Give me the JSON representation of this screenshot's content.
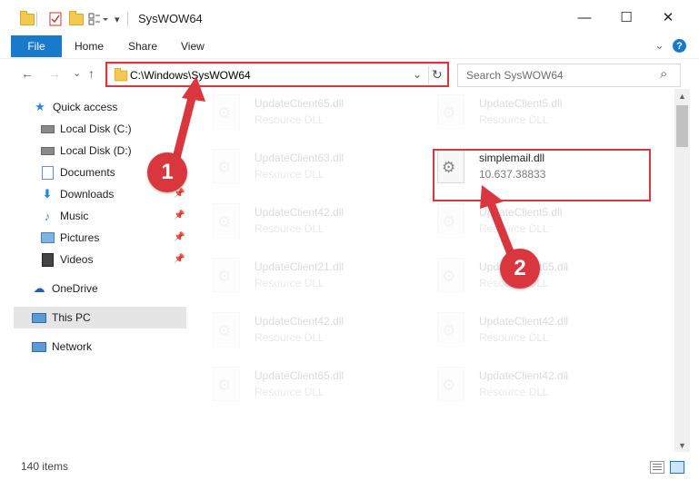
{
  "window": {
    "title": "SysWOW64",
    "minimize": "—",
    "maximize": "☐",
    "close": "✕"
  },
  "ribbon": {
    "file": "File",
    "home": "Home",
    "share": "Share",
    "view": "View",
    "help": "?",
    "expand": "⌄"
  },
  "nav": {
    "back": "←",
    "forward": "→",
    "recent": "⌄",
    "up": "↑",
    "address": "C:\\Windows\\SysWOW64",
    "address_dropdown": "⌄",
    "refresh": "↻",
    "search_placeholder": "Search SysWOW64",
    "search_icon": "⌕"
  },
  "sidebar": {
    "items": [
      {
        "label": "Quick access",
        "icon": "star-icon"
      },
      {
        "label": "Local Disk (C:)",
        "icon": "drive-icon"
      },
      {
        "label": "Local Disk (D:)",
        "icon": "drive-icon"
      },
      {
        "label": "Documents",
        "icon": "documents-icon"
      },
      {
        "label": "Downloads",
        "icon": "download-icon"
      },
      {
        "label": "Music",
        "icon": "music-icon"
      },
      {
        "label": "Pictures",
        "icon": "pictures-icon"
      },
      {
        "label": "Videos",
        "icon": "videos-icon"
      },
      {
        "label": "OneDrive",
        "icon": "cloud-icon"
      },
      {
        "label": "This PC",
        "icon": "computer-icon"
      },
      {
        "label": "Network",
        "icon": "network-icon"
      }
    ]
  },
  "files": [
    {
      "name": "UpdateClient65.dll",
      "type": "Resource DLL"
    },
    {
      "name": "UpdateClient5.dll",
      "type": "Resource DLL"
    },
    {
      "name": "UpdateClient63.dll",
      "type": "Resource DLL"
    },
    {
      "name": "simplemail.dll",
      "type": "10.637.38833"
    },
    {
      "name": "UpdateClient42.dll",
      "type": "Resource DLL"
    },
    {
      "name": "UpdateClient5.dll",
      "type": "Resource DLL"
    },
    {
      "name": "UpdateClient21.dll",
      "type": "Resource DLL"
    },
    {
      "name": "UpdateClient65.dll",
      "type": "Resource DLL"
    },
    {
      "name": "UpdateClient42.dll",
      "type": "Resource DLL"
    },
    {
      "name": "UpdateClient42.dll",
      "type": "Resource DLL"
    },
    {
      "name": "UpdateClient65.dll",
      "type": "Resource DLL"
    },
    {
      "name": "UpdateClient42.dll",
      "type": "Resource DLL"
    }
  ],
  "status": {
    "count": "140 items"
  },
  "annotations": {
    "step1": "1",
    "step2": "2"
  },
  "colors": {
    "accent": "#1979ca",
    "highlight": "#d9363e",
    "selected_bg": "#e5e5e5"
  }
}
